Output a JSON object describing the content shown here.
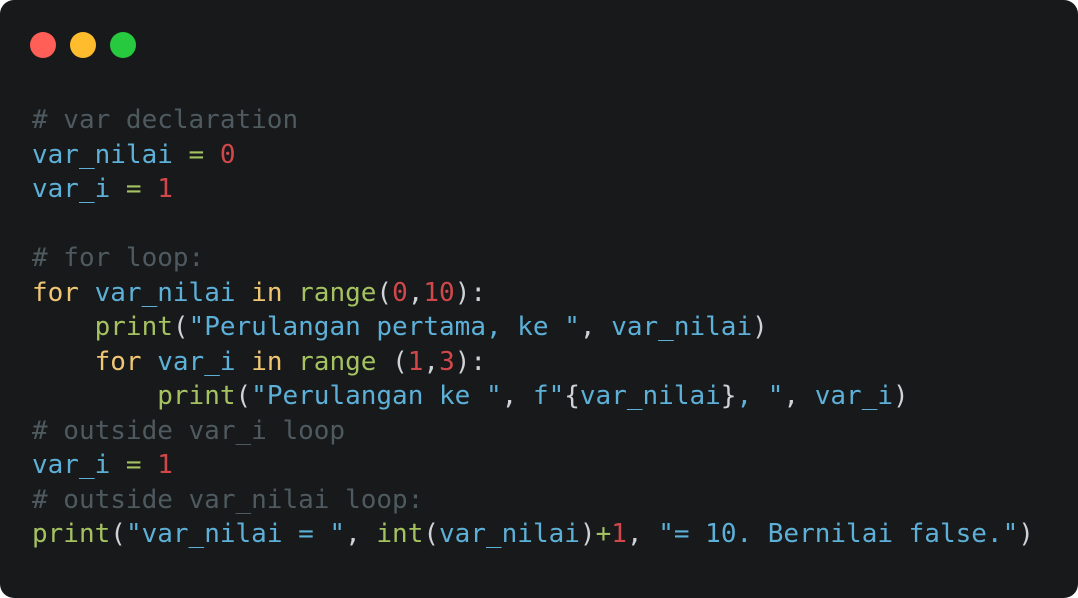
{
  "window": {
    "buttons": [
      {
        "name": "close",
        "color": "#ff5f56"
      },
      {
        "name": "minimize",
        "color": "#ffbd2e"
      },
      {
        "name": "maximize",
        "color": "#27c93f"
      }
    ]
  },
  "colors": {
    "comment": "#4e5a5f",
    "identifier": "#5db0d7",
    "operator": "#a5c261",
    "number": "#d2484a",
    "keyword": "#f0c674",
    "function": "#a5c261",
    "string": "#5db0d7",
    "punctuation": "#cfd2d6"
  },
  "code_lines": [
    [
      {
        "t": "# var declaration",
        "k": "comment"
      }
    ],
    [
      {
        "t": "var_nilai",
        "k": "identifier"
      },
      {
        "t": " = ",
        "k": "operator"
      },
      {
        "t": "0",
        "k": "number"
      }
    ],
    [
      {
        "t": "var_i",
        "k": "identifier"
      },
      {
        "t": " = ",
        "k": "operator"
      },
      {
        "t": "1",
        "k": "number"
      }
    ],
    [],
    [
      {
        "t": "# for loop:",
        "k": "comment"
      }
    ],
    [
      {
        "t": "for",
        "k": "keyword"
      },
      {
        "t": " ",
        "k": "punctuation"
      },
      {
        "t": "var_nilai",
        "k": "identifier"
      },
      {
        "t": " ",
        "k": "punctuation"
      },
      {
        "t": "in",
        "k": "keyword"
      },
      {
        "t": " ",
        "k": "punctuation"
      },
      {
        "t": "range",
        "k": "function"
      },
      {
        "t": "(",
        "k": "punctuation"
      },
      {
        "t": "0",
        "k": "number"
      },
      {
        "t": ",",
        "k": "punctuation"
      },
      {
        "t": "10",
        "k": "number"
      },
      {
        "t": "):",
        "k": "punctuation"
      }
    ],
    [
      {
        "t": "    ",
        "k": "punctuation"
      },
      {
        "t": "print",
        "k": "function"
      },
      {
        "t": "(",
        "k": "punctuation"
      },
      {
        "t": "\"Perulangan pertama, ke \"",
        "k": "string"
      },
      {
        "t": ", ",
        "k": "punctuation"
      },
      {
        "t": "var_nilai",
        "k": "identifier"
      },
      {
        "t": ")",
        "k": "punctuation"
      }
    ],
    [
      {
        "t": "    ",
        "k": "punctuation"
      },
      {
        "t": "for",
        "k": "keyword"
      },
      {
        "t": " ",
        "k": "punctuation"
      },
      {
        "t": "var_i",
        "k": "identifier"
      },
      {
        "t": " ",
        "k": "punctuation"
      },
      {
        "t": "in",
        "k": "keyword"
      },
      {
        "t": " ",
        "k": "punctuation"
      },
      {
        "t": "range",
        "k": "function"
      },
      {
        "t": " (",
        "k": "punctuation"
      },
      {
        "t": "1",
        "k": "number"
      },
      {
        "t": ",",
        "k": "punctuation"
      },
      {
        "t": "3",
        "k": "number"
      },
      {
        "t": "):",
        "k": "punctuation"
      }
    ],
    [
      {
        "t": "        ",
        "k": "punctuation"
      },
      {
        "t": "print",
        "k": "function"
      },
      {
        "t": "(",
        "k": "punctuation"
      },
      {
        "t": "\"Perulangan ke \"",
        "k": "string"
      },
      {
        "t": ", ",
        "k": "punctuation"
      },
      {
        "t": "f\"",
        "k": "string"
      },
      {
        "t": "{",
        "k": "punctuation"
      },
      {
        "t": "var_nilai",
        "k": "identifier"
      },
      {
        "t": "}",
        "k": "punctuation"
      },
      {
        "t": ", \"",
        "k": "string"
      },
      {
        "t": ", ",
        "k": "punctuation"
      },
      {
        "t": "var_i",
        "k": "identifier"
      },
      {
        "t": ")",
        "k": "punctuation"
      }
    ],
    [
      {
        "t": "# outside var_i loop",
        "k": "comment"
      }
    ],
    [
      {
        "t": "var_i",
        "k": "identifier"
      },
      {
        "t": " = ",
        "k": "operator"
      },
      {
        "t": "1",
        "k": "number"
      }
    ],
    [
      {
        "t": "# outside var_nilai loop:",
        "k": "comment"
      }
    ],
    [
      {
        "t": "print",
        "k": "function"
      },
      {
        "t": "(",
        "k": "punctuation"
      },
      {
        "t": "\"var_nilai = \"",
        "k": "string"
      },
      {
        "t": ", ",
        "k": "punctuation"
      },
      {
        "t": "int",
        "k": "function"
      },
      {
        "t": "(",
        "k": "punctuation"
      },
      {
        "t": "var_nilai",
        "k": "identifier"
      },
      {
        "t": ")",
        "k": "punctuation"
      },
      {
        "t": "+",
        "k": "operator"
      },
      {
        "t": "1",
        "k": "number"
      },
      {
        "t": ", ",
        "k": "punctuation"
      },
      {
        "t": "\"= 10. Bernilai false.\"",
        "k": "string"
      },
      {
        "t": ")",
        "k": "punctuation"
      }
    ]
  ]
}
